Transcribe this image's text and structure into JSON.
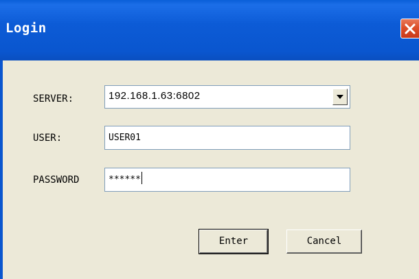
{
  "window": {
    "title": "Login"
  },
  "form": {
    "server_label": "SERVER:",
    "server_value": "192.168.1.63:6802",
    "user_label": "USER:",
    "user_value": "USER01",
    "password_label": "PASSWORD",
    "password_value": "******"
  },
  "buttons": {
    "enter_label": "Enter",
    "cancel_label": "Cancel"
  },
  "icons": {
    "close": "close-icon",
    "dropdown": "chevron-down-icon"
  },
  "colors": {
    "titlebar": "#0a56cf",
    "close_button": "#dd4f2a",
    "dialog_background": "#ece9d8"
  }
}
